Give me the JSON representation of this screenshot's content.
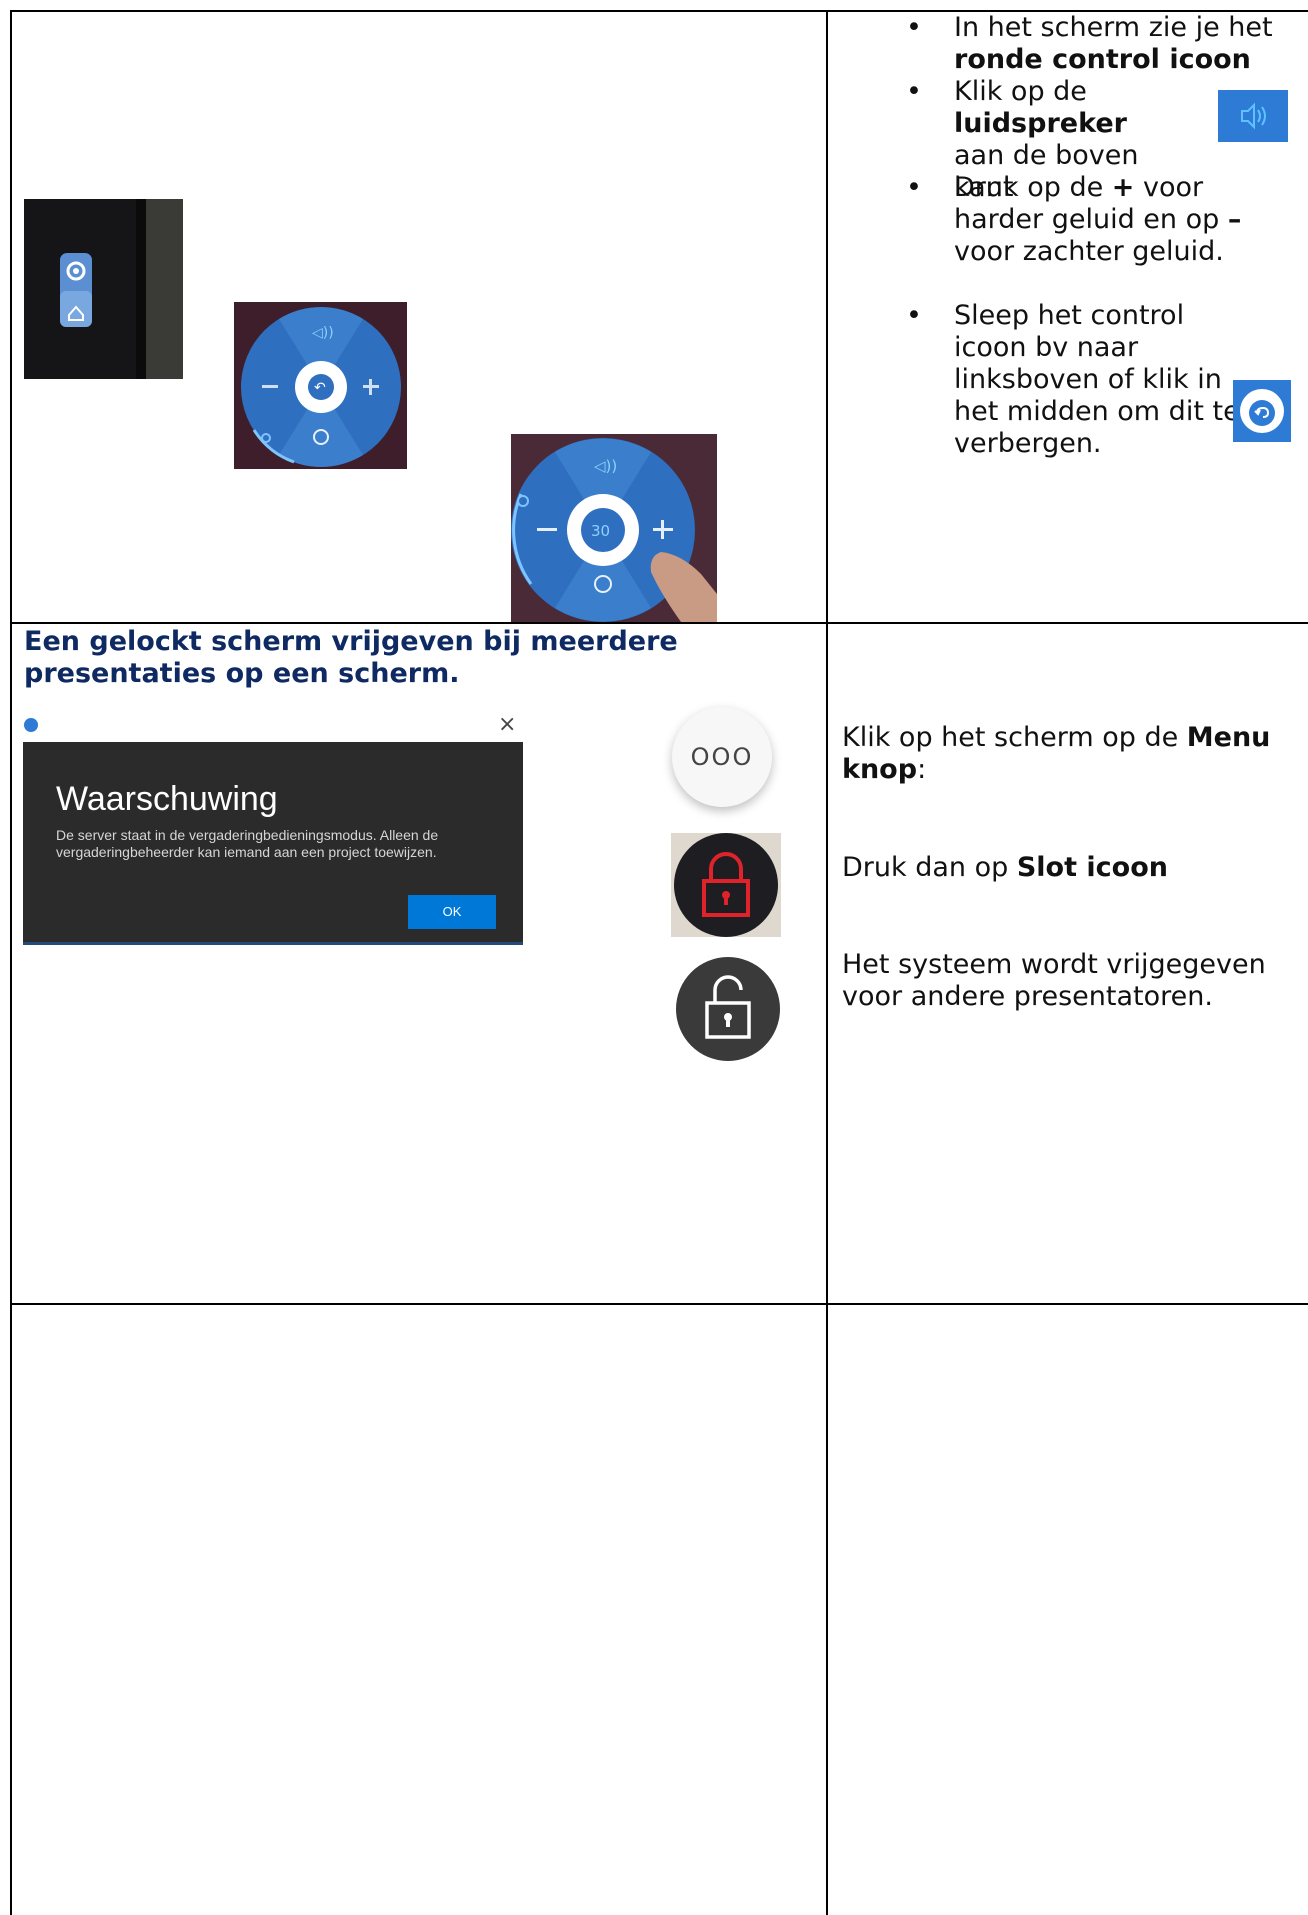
{
  "section1": {
    "bullets": [
      {
        "pre": "In het scherm zie je het ",
        "bold": "ronde control icoon",
        "post": ""
      },
      {
        "pre": "Klik op de ",
        "bold": "luidspreker",
        "post": " aan de boven kant"
      },
      {
        "pre": "Druk op de ",
        "bold": "+",
        "mid": " voor harder geluid en op ",
        "bold2": "–",
        "post": " voor zachter geluid."
      },
      {
        "pre": "Sleep het control icoon bv naar linksboven of klik in het midden om dit te verbergen.",
        "bold": "",
        "post": ""
      }
    ],
    "dial_center_value": "30"
  },
  "section2": {
    "heading": "Een gelockt scherm vrijgeven bij meerdere presentaties op een scherm.",
    "dialog": {
      "title": "Waarschuwing",
      "message": "De server staat in de vergaderingbedieningsmodus. Alleen de vergaderingbeheerder kan iemand aan een project toewijzen.",
      "ok": "OK",
      "close": "×"
    },
    "menu_icon_text": "OOO",
    "steps": [
      {
        "pre": "Klik op het scherm op de ",
        "bold": "Menu knop",
        "post": ":"
      },
      {
        "pre": "Druk dan op ",
        "bold": "Slot icoon",
        "post": ""
      },
      {
        "pre": "Het systeem wordt vrijgegeven voor andere presentatoren.",
        "bold": "",
        "post": ""
      }
    ]
  },
  "colors": {
    "heading": "#0f2a63",
    "accent_blue": "#2e7bd6",
    "dialog_bg": "#2b2b2b",
    "ok_blue": "#0078d7"
  }
}
